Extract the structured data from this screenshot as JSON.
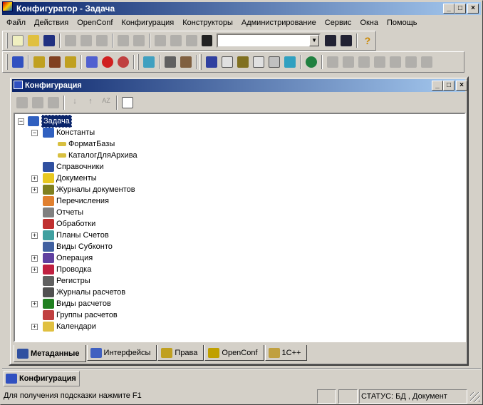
{
  "app": {
    "title": "Конфигуратор - Задача"
  },
  "menu": [
    "Файл",
    "Действия",
    "OpenConf",
    "Конфигурация",
    "Конструкторы",
    "Администрирование",
    "Сервис",
    "Окна",
    "Помощь"
  ],
  "child": {
    "title": "Конфигурация"
  },
  "tree": {
    "root": "Задача",
    "items": [
      {
        "label": "Константы",
        "level": 1,
        "expander": "minus",
        "color": "#3060c0"
      },
      {
        "label": "ФорматБазы",
        "level": 2,
        "expander": "",
        "color": "#d8c040"
      },
      {
        "label": "КаталогДляАрхива",
        "level": 2,
        "expander": "",
        "color": "#d8c040"
      },
      {
        "label": "Справочники",
        "level": 1,
        "expander": "",
        "color": "#3050a0"
      },
      {
        "label": "Документы",
        "level": 1,
        "expander": "plus",
        "color": "#e8c820"
      },
      {
        "label": "Журналы документов",
        "level": 1,
        "expander": "plus",
        "color": "#808020"
      },
      {
        "label": "Перечисления",
        "level": 1,
        "expander": "",
        "color": "#e08030"
      },
      {
        "label": "Отчеты",
        "level": 1,
        "expander": "",
        "color": "#808080"
      },
      {
        "label": "Обработки",
        "level": 1,
        "expander": "",
        "color": "#c03030"
      },
      {
        "label": "Планы Счетов",
        "level": 1,
        "expander": "plus",
        "color": "#40a0a0"
      },
      {
        "label": "Виды Субконто",
        "level": 1,
        "expander": "",
        "color": "#4060a0"
      },
      {
        "label": "Операция",
        "level": 1,
        "expander": "plus",
        "color": "#6040a0"
      },
      {
        "label": "Проводка",
        "level": 1,
        "expander": "plus",
        "color": "#c02040"
      },
      {
        "label": "Регистры",
        "level": 1,
        "expander": "",
        "color": "#606060"
      },
      {
        "label": "Журналы расчетов",
        "level": 1,
        "expander": "",
        "color": "#505050"
      },
      {
        "label": "Виды расчетов",
        "level": 1,
        "expander": "plus",
        "color": "#208020"
      },
      {
        "label": "Группы расчетов",
        "level": 1,
        "expander": "",
        "color": "#c04040"
      },
      {
        "label": "Календари",
        "level": 1,
        "expander": "plus",
        "color": "#e0c040"
      }
    ]
  },
  "tabs": [
    {
      "label": "Метаданные",
      "active": true
    },
    {
      "label": "Интерфейсы",
      "active": false
    },
    {
      "label": "Права",
      "active": false
    },
    {
      "label": "OpenConf",
      "active": false
    },
    {
      "label": "1С++",
      "active": false
    }
  ],
  "taskbar": {
    "label": "Конфигурация"
  },
  "status": {
    "hint": "Для получения подсказки нажмите F1",
    "state": "СТАТУС: БД , Документ"
  },
  "search": {
    "value": ""
  }
}
